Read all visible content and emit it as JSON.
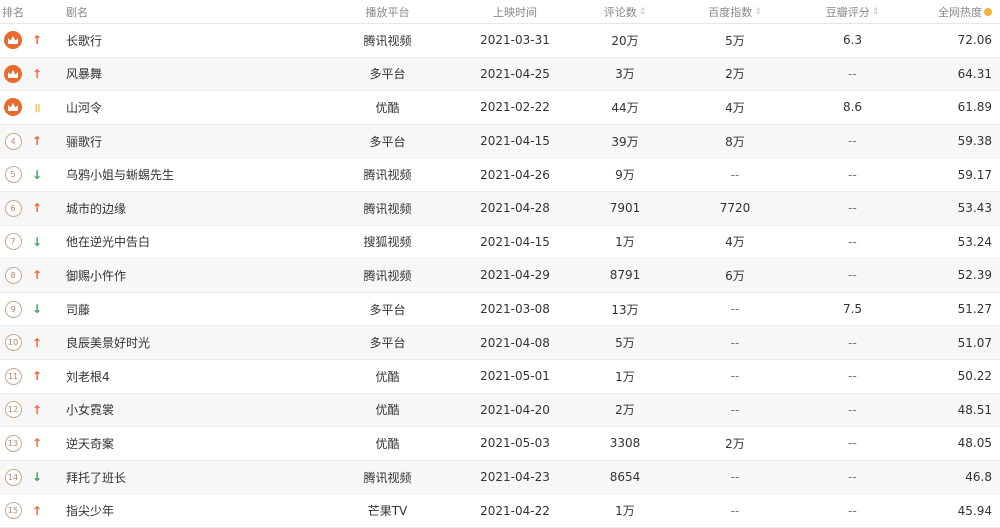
{
  "header": {
    "rank": "排名",
    "name": "剧名",
    "platform": "播放平台",
    "date": "上映时间",
    "comments": "评论数",
    "baidu": "百度指数",
    "douban": "豆瓣评分",
    "heat": "全网热度"
  },
  "colors": {
    "up": "#f0623a",
    "down": "#3aa95c",
    "same": "#f2c84b",
    "crown": "#e86a2c"
  },
  "rows": [
    {
      "rank": "1",
      "badge": "crown-icon",
      "trend": "up",
      "trend_glyph": "↑",
      "name": "长歌行",
      "platform": "腾讯视频",
      "date": "2021-03-31",
      "comments": "20万",
      "baidu": "5万",
      "douban": "6.3",
      "heat": "72.06"
    },
    {
      "rank": "2",
      "badge": "crown-icon",
      "trend": "up",
      "trend_glyph": "↑",
      "name": "风暴舞",
      "platform": "多平台",
      "date": "2021-04-25",
      "comments": "3万",
      "baidu": "2万",
      "douban": "--",
      "heat": "64.31"
    },
    {
      "rank": "3",
      "badge": "crown-icon",
      "trend": "same",
      "trend_glyph": "॥",
      "name": "山河令",
      "platform": "优酷",
      "date": "2021-02-22",
      "comments": "44万",
      "baidu": "4万",
      "douban": "8.6",
      "heat": "61.89"
    },
    {
      "rank": "4",
      "badge": "number",
      "trend": "up",
      "trend_glyph": "↑",
      "name": "骊歌行",
      "platform": "多平台",
      "date": "2021-04-15",
      "comments": "39万",
      "baidu": "8万",
      "douban": "--",
      "heat": "59.38"
    },
    {
      "rank": "5",
      "badge": "number",
      "trend": "down",
      "trend_glyph": "↓",
      "name": "乌鸦小姐与蜥蜴先生",
      "platform": "腾讯视频",
      "date": "2021-04-26",
      "comments": "9万",
      "baidu": "--",
      "douban": "--",
      "heat": "59.17"
    },
    {
      "rank": "6",
      "badge": "number",
      "trend": "up",
      "trend_glyph": "↑",
      "name": "城市的边缘",
      "platform": "腾讯视频",
      "date": "2021-04-28",
      "comments": "7901",
      "baidu": "7720",
      "douban": "--",
      "heat": "53.43"
    },
    {
      "rank": "7",
      "badge": "number",
      "trend": "down",
      "trend_glyph": "↓",
      "name": "他在逆光中告白",
      "platform": "搜狐视频",
      "date": "2021-04-15",
      "comments": "1万",
      "baidu": "4万",
      "douban": "--",
      "heat": "53.24"
    },
    {
      "rank": "8",
      "badge": "number",
      "trend": "up",
      "trend_glyph": "↑",
      "name": "御赐小仵作",
      "platform": "腾讯视频",
      "date": "2021-04-29",
      "comments": "8791",
      "baidu": "6万",
      "douban": "--",
      "heat": "52.39"
    },
    {
      "rank": "9",
      "badge": "number",
      "trend": "down",
      "trend_glyph": "↓",
      "name": "司藤",
      "platform": "多平台",
      "date": "2021-03-08",
      "comments": "13万",
      "baidu": "--",
      "douban": "7.5",
      "heat": "51.27"
    },
    {
      "rank": "10",
      "badge": "number",
      "trend": "up",
      "trend_glyph": "↑",
      "name": "良辰美景好时光",
      "platform": "多平台",
      "date": "2021-04-08",
      "comments": "5万",
      "baidu": "--",
      "douban": "--",
      "heat": "51.07"
    },
    {
      "rank": "11",
      "badge": "number",
      "trend": "up",
      "trend_glyph": "↑",
      "name": "刘老根4",
      "platform": "优酷",
      "date": "2021-05-01",
      "comments": "1万",
      "baidu": "--",
      "douban": "--",
      "heat": "50.22"
    },
    {
      "rank": "12",
      "badge": "number",
      "trend": "up",
      "trend_glyph": "↑",
      "name": "小女霓裳",
      "platform": "优酷",
      "date": "2021-04-20",
      "comments": "2万",
      "baidu": "--",
      "douban": "--",
      "heat": "48.51"
    },
    {
      "rank": "13",
      "badge": "number",
      "trend": "up",
      "trend_glyph": "↑",
      "name": "逆天奇案",
      "platform": "优酷",
      "date": "2021-05-03",
      "comments": "3308",
      "baidu": "2万",
      "douban": "--",
      "heat": "48.05"
    },
    {
      "rank": "14",
      "badge": "number",
      "trend": "down",
      "trend_glyph": "↓",
      "name": "拜托了班长",
      "platform": "腾讯视频",
      "date": "2021-04-23",
      "comments": "8654",
      "baidu": "--",
      "douban": "--",
      "heat": "46.8"
    },
    {
      "rank": "15",
      "badge": "number",
      "trend": "up",
      "trend_glyph": "↑",
      "name": "指尖少年",
      "platform": "芒果TV",
      "date": "2021-04-22",
      "comments": "1万",
      "baidu": "--",
      "douban": "--",
      "heat": "45.94"
    }
  ]
}
